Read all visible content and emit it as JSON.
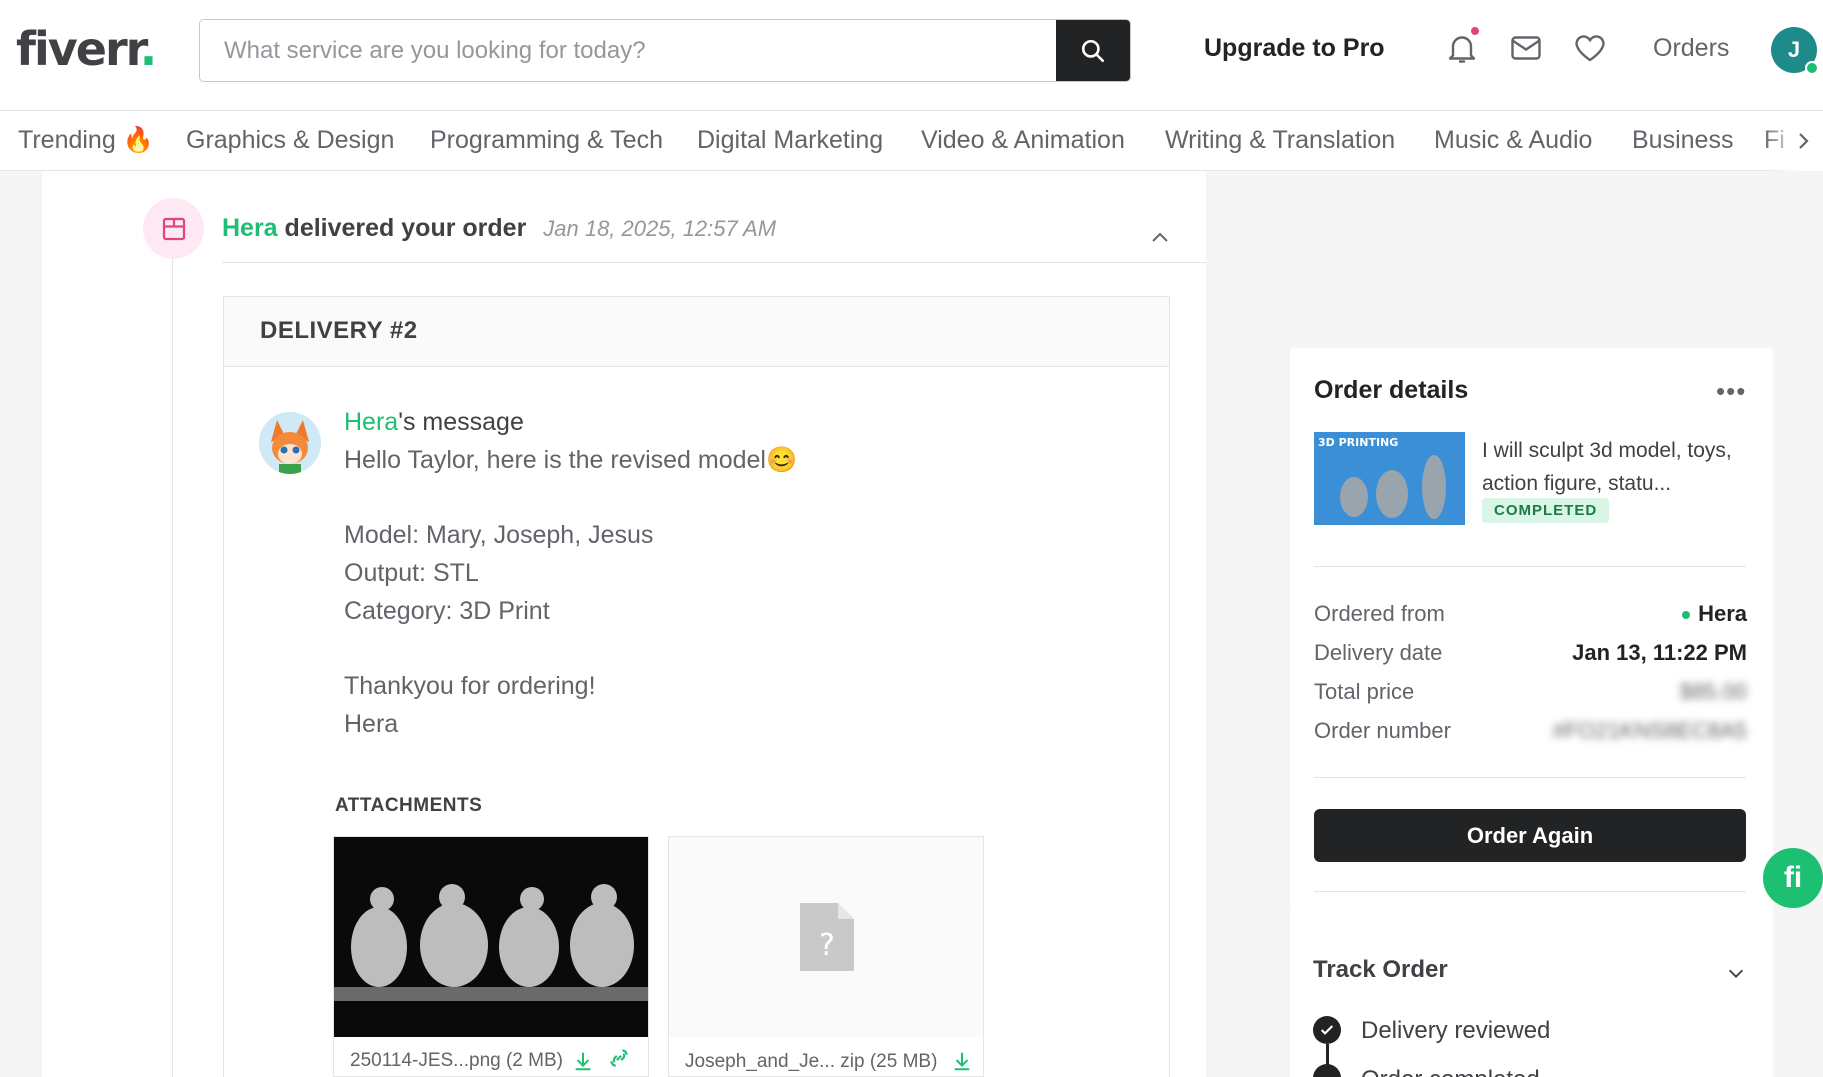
{
  "header": {
    "logo_text": "fiverr",
    "logo_dot": ".",
    "search_placeholder": "What service are you looking for today?",
    "upgrade_label": "Upgrade to Pro",
    "orders_label": "Orders",
    "user_initial": "J"
  },
  "categories": [
    "Trending",
    "Graphics & Design",
    "Programming & Tech",
    "Digital Marketing",
    "Video & Animation",
    "Writing & Translation",
    "Music & Audio",
    "Business",
    "Fi"
  ],
  "event": {
    "seller": "Hera",
    "verb": "delivered your order",
    "date": "Jan 18, 2025, 12:57 AM"
  },
  "delivery": {
    "title": "DELIVERY #2",
    "msg_seller": "Hera",
    "msg_suffix": "'s message",
    "lines": [
      "Hello Taylor, here is the revised model",
      "Model: Mary, Joseph, Jesus",
      "Output: STL",
      "Category: 3D Print",
      "Thankyou for ordering!",
      "Hera"
    ],
    "emoji": "😊",
    "attachments_label": "ATTACHMENTS",
    "attachments": [
      {
        "name": "250114-JES...png (2 MB)"
      },
      {
        "name": "Joseph_and_Je... zip (25 MB)"
      }
    ]
  },
  "order_details": {
    "title": "Order details",
    "more": "•••",
    "gig_title": "I will sculpt 3d model, toys, action figure, statu...",
    "gig_banner": "3D PRINTING",
    "status": "COMPLETED",
    "rows": [
      {
        "label": "Ordered from",
        "value": "Hera"
      },
      {
        "label": "Delivery date",
        "value": "Jan 13, 11:22 PM"
      },
      {
        "label": "Total price",
        "value": "$85.00"
      },
      {
        "label": "Order number",
        "value": "#FO21KNS8EC8A5"
      }
    ],
    "order_again": "Order Again"
  },
  "track": {
    "title": "Track Order",
    "items": [
      "Delivery reviewed",
      "Order completed"
    ]
  },
  "fi_button": "fi",
  "colors": {
    "brand_green": "#1dbf73",
    "dark": "#222325"
  }
}
